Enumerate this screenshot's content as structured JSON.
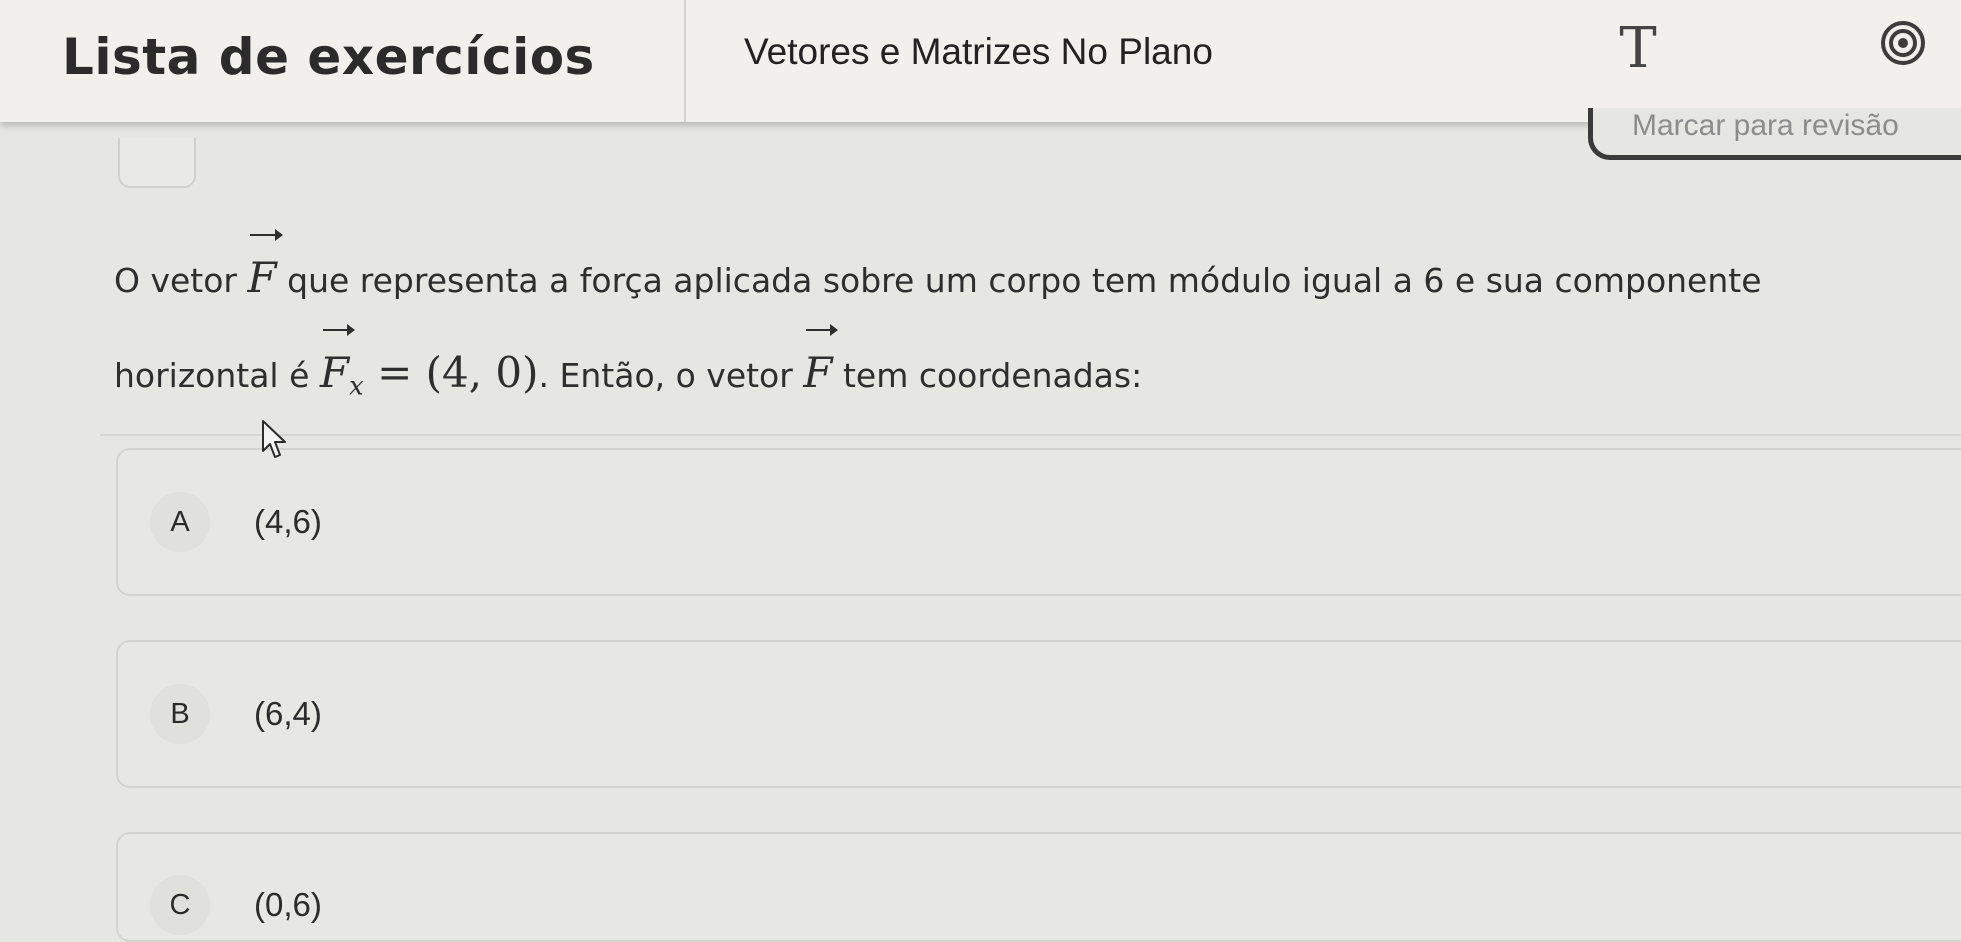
{
  "header": {
    "title": "Lista de exercícios",
    "subtitle": "Vetores e Matrizes No Plano",
    "text_tool_label": "T",
    "target_icon": "target-icon"
  },
  "review": {
    "label": "Marcar para revisão"
  },
  "question": {
    "part1": "O vetor ",
    "vector_symbol": "F",
    "part2": " que representa a força aplicada sobre um corpo tem módulo igual a 6 e sua componente horizontal é ",
    "sub_symbol": "x",
    "equals": " = (4, 0)",
    "part3": ". Então, o vetor ",
    "part4": " tem coordenadas:"
  },
  "options": [
    {
      "letter": "A",
      "value": "(4,6)"
    },
    {
      "letter": "B",
      "value": "(6,4)"
    },
    {
      "letter": "C",
      "value": "(0,6)"
    }
  ],
  "colors": {
    "background": "#e6e6e2",
    "header": "#f1f0ec",
    "text": "#2e2e2e"
  }
}
